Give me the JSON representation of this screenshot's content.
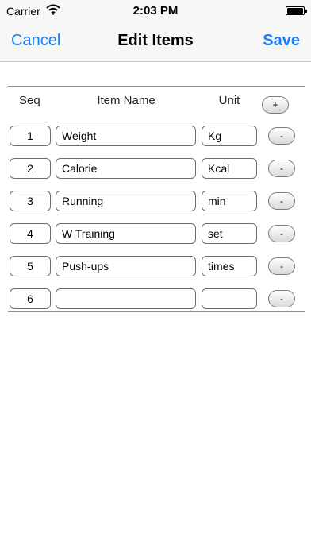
{
  "status_bar": {
    "carrier": "Carrier",
    "time": "2:03 PM"
  },
  "nav": {
    "cancel": "Cancel",
    "title": "Edit Items",
    "save": "Save"
  },
  "table": {
    "headers": {
      "seq": "Seq",
      "item_name": "Item Name",
      "unit": "Unit"
    },
    "add_label": "+",
    "remove_label": "-",
    "rows": [
      {
        "seq": "1",
        "name": "Weight",
        "unit": "Kg"
      },
      {
        "seq": "2",
        "name": "Calorie",
        "unit": "Kcal"
      },
      {
        "seq": "3",
        "name": "Running",
        "unit": "min"
      },
      {
        "seq": "4",
        "name": "W Training",
        "unit": "set"
      },
      {
        "seq": "5",
        "name": "Push-ups",
        "unit": "times"
      },
      {
        "seq": "6",
        "name": "",
        "unit": ""
      }
    ]
  },
  "colors": {
    "accent": "#1a7ef6",
    "bar_background": "#f7f7f7"
  }
}
